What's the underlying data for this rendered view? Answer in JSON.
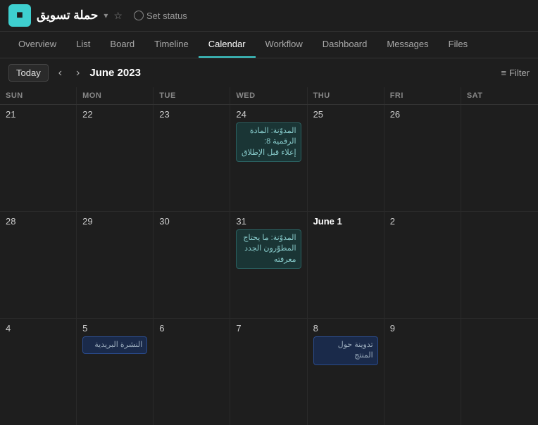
{
  "topbar": {
    "app_icon": "■",
    "project_name": "حملة تسويق",
    "set_status_label": "Set status"
  },
  "nav": {
    "tabs": [
      {
        "label": "Overview",
        "active": false
      },
      {
        "label": "List",
        "active": false
      },
      {
        "label": "Board",
        "active": false
      },
      {
        "label": "Timeline",
        "active": false
      },
      {
        "label": "Calendar",
        "active": true
      },
      {
        "label": "Workflow",
        "active": false
      },
      {
        "label": "Dashboard",
        "active": false
      },
      {
        "label": "Messages",
        "active": false
      },
      {
        "label": "Files",
        "active": false
      }
    ]
  },
  "calendar": {
    "today_label": "Today",
    "month_title": "June 2023",
    "filter_label": "Filter",
    "day_headers": [
      "SUN",
      "MON",
      "TUE",
      "WED",
      "THU",
      "FRI",
      "SAT"
    ],
    "rows": [
      {
        "cells": [
          {
            "day": "21",
            "events": []
          },
          {
            "day": "22",
            "events": []
          },
          {
            "day": "23",
            "events": []
          },
          {
            "day": "24",
            "events": [
              {
                "text": "المدوّنة: المادة الرقمية 8: إعلاء قبل الإطلاق",
                "style": "teal"
              }
            ]
          },
          {
            "day": "25",
            "events": []
          },
          {
            "day": "26",
            "events": []
          },
          {
            "day": "",
            "events": []
          }
        ]
      },
      {
        "cells": [
          {
            "day": "28",
            "events": []
          },
          {
            "day": "29",
            "events": []
          },
          {
            "day": "30",
            "events": []
          },
          {
            "day": "31",
            "events": [
              {
                "text": "المدوّنة: ما يحتاج المطوّرون الجدد معرفته",
                "style": "teal"
              }
            ]
          },
          {
            "day": "June 1",
            "june": true,
            "events": []
          },
          {
            "day": "2",
            "events": []
          },
          {
            "day": "",
            "events": []
          }
        ]
      },
      {
        "cells": [
          {
            "day": "4",
            "events": []
          },
          {
            "day": "5",
            "events": [
              {
                "text": "النشرة البريدية",
                "style": "blue"
              }
            ]
          },
          {
            "day": "6",
            "events": []
          },
          {
            "day": "7",
            "events": []
          },
          {
            "day": "8",
            "events": [
              {
                "text": "تدوينة حول المنتج",
                "style": "blue"
              }
            ]
          },
          {
            "day": "9",
            "events": []
          },
          {
            "day": "",
            "events": []
          }
        ]
      }
    ]
  }
}
